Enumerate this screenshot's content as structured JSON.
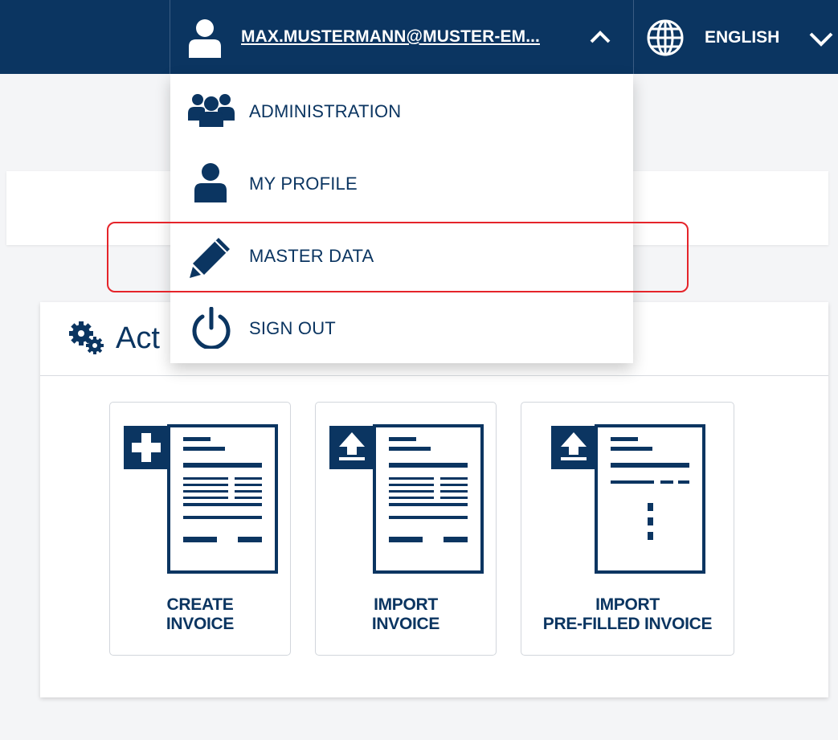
{
  "header": {
    "user_email": "MAX.MUSTERMANN@MUSTER-EM...",
    "user_icon": "user-icon",
    "menu_toggle_icon": "chevron-up-icon",
    "language": "ENGLISH",
    "language_icon": "globe-icon",
    "language_toggle_icon": "chevron-down-icon"
  },
  "dropdown": {
    "items": [
      {
        "label": "ADMINISTRATION",
        "icon": "users-icon"
      },
      {
        "label": "MY PROFILE",
        "icon": "user-icon"
      },
      {
        "label": "MASTER DATA",
        "icon": "pencil-icon",
        "highlighted": true
      },
      {
        "label": "SIGN OUT",
        "icon": "power-icon"
      }
    ]
  },
  "actions_panel": {
    "title": "Act",
    "title_icon": "gears-icon",
    "tiles": [
      {
        "line1": "CREATE",
        "line2": "INVOICE",
        "icon": "create-invoice-icon"
      },
      {
        "line1": "IMPORT",
        "line2": "INVOICE",
        "icon": "import-invoice-icon"
      },
      {
        "line1": "IMPORT",
        "line2": "PRE-FILLED INVOICE",
        "icon": "import-prefilled-invoice-icon"
      }
    ]
  },
  "colors": {
    "brand_navy": "#0b3561",
    "highlight_red": "#e5242a",
    "page_background": "#f4f5f7"
  }
}
